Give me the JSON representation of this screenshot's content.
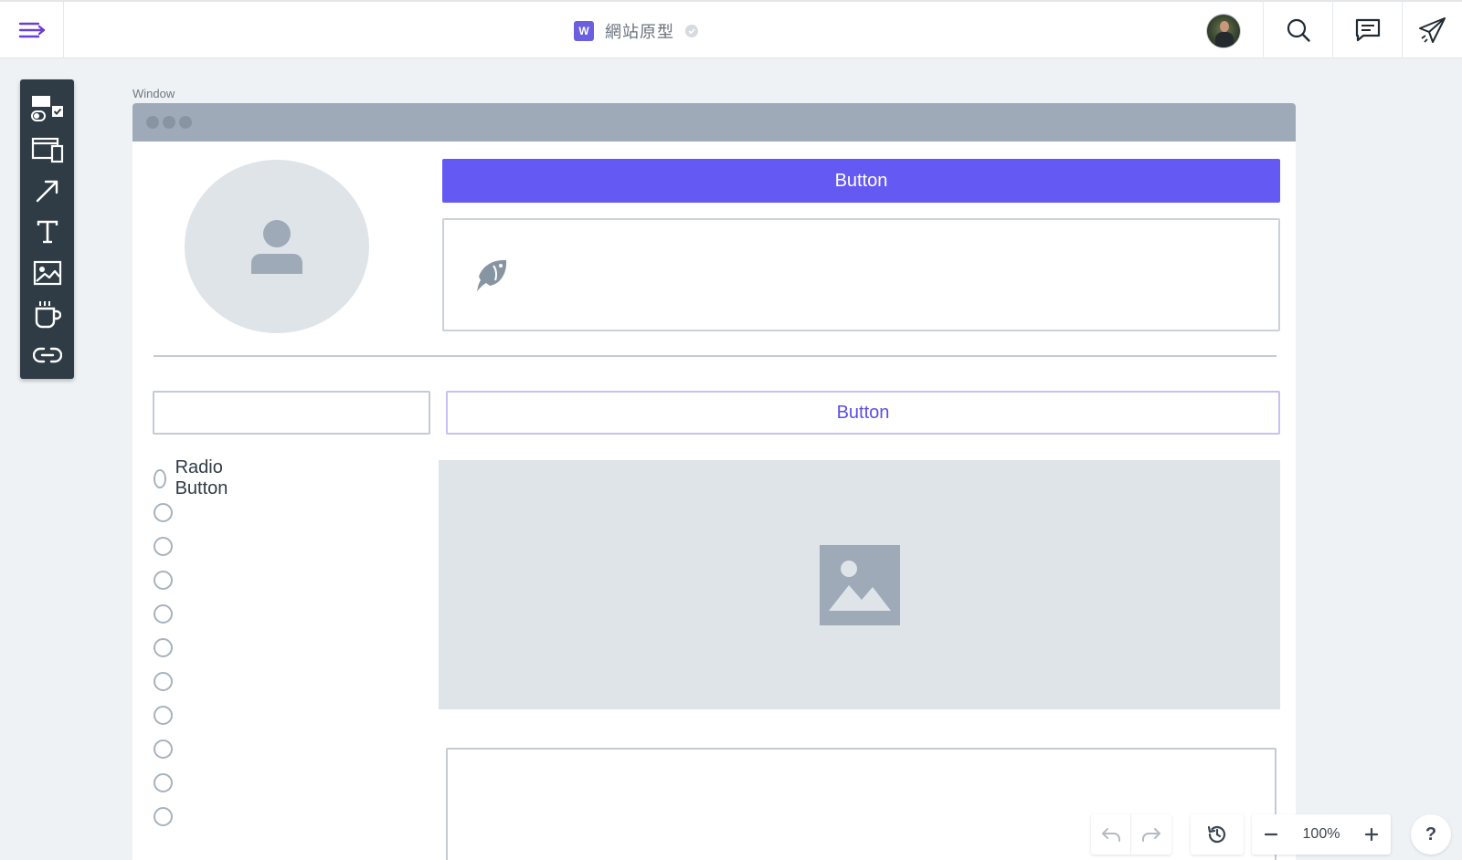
{
  "topbar": {
    "doc_badge": "W",
    "doc_title": "網站原型"
  },
  "canvas": {
    "window_label": "Window",
    "primary_button_label": "Button",
    "outline_button_label": "Button",
    "radio_label": "Radio Button"
  },
  "zoom": {
    "level": "100%"
  },
  "help_label": "?",
  "icons": {
    "menu": "menu-arrow-icon",
    "search": "search-icon",
    "comments": "comment-icon",
    "share": "send-icon",
    "undo": "undo-icon",
    "redo": "redo-icon",
    "history": "history-icon"
  },
  "colors": {
    "accent": "#6559f4",
    "toolbar_bg": "#2f3b45",
    "placeholder": "#dfe4e9"
  }
}
